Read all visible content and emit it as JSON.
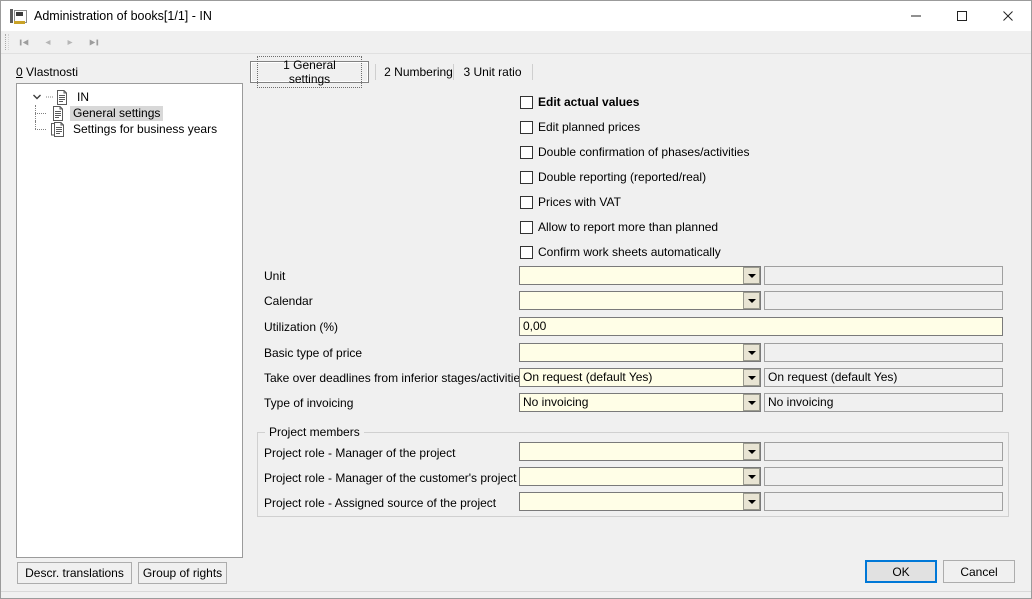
{
  "window": {
    "title": "Administration of books[1/1] - IN",
    "app_icon": "book-document-icon",
    "controls": {
      "minimize": "minimize-icon",
      "maximize": "maximize-icon",
      "close": "close-icon"
    }
  },
  "toolbar": {
    "buttons": [
      {
        "name": "first-record",
        "icon": "first-record-icon"
      },
      {
        "name": "previous-record",
        "icon": "previous-record-icon"
      },
      {
        "name": "next-record",
        "icon": "next-record-icon"
      },
      {
        "name": "last-record",
        "icon": "last-record-icon"
      }
    ]
  },
  "left_pane": {
    "caption_accel": "0",
    "caption_text": " Vlastnosti",
    "tree": {
      "root": {
        "label": "IN",
        "expanded": true
      },
      "children": [
        {
          "label": "General settings",
          "selected": true
        },
        {
          "label": "Settings for business years",
          "selected": false
        }
      ]
    },
    "buttons": {
      "descr_translations": "Descr. translations",
      "group_of_rights": "Group of rights"
    }
  },
  "tabs": [
    {
      "label": "1 General settings",
      "active": true
    },
    {
      "label": "2 Numbering",
      "active": false
    },
    {
      "label": "3 Unit ratio",
      "active": false
    }
  ],
  "checkboxes": [
    {
      "label": "Edit actual values",
      "checked": false,
      "bold": true
    },
    {
      "label": "Edit planned prices",
      "checked": false,
      "bold": false
    },
    {
      "label": "Double confirmation of phases/activities",
      "checked": false,
      "bold": false
    },
    {
      "label": "Double reporting (reported/real)",
      "checked": false,
      "bold": false
    },
    {
      "label": "Prices with VAT",
      "checked": false,
      "bold": false
    },
    {
      "label": "Allow to report more than planned",
      "checked": false,
      "bold": false
    },
    {
      "label": "Confirm work sheets automatically",
      "checked": false,
      "bold": false
    }
  ],
  "fields": [
    {
      "label": "Unit",
      "type": "combo",
      "value": "",
      "readonly_value": ""
    },
    {
      "label": "Calendar",
      "type": "combo",
      "value": "",
      "readonly_value": ""
    },
    {
      "label": "Utilization (%)",
      "type": "text",
      "value": "0,00"
    },
    {
      "label": "Basic type of price",
      "type": "combo",
      "value": "",
      "readonly_value": ""
    },
    {
      "label": "Take over deadlines from inferior stages/activitie...",
      "type": "combo",
      "value": "On request (default Yes)",
      "readonly_value": "On request (default Yes)"
    },
    {
      "label": "Type of invoicing",
      "type": "combo",
      "value": "No invoicing",
      "readonly_value": "No invoicing"
    }
  ],
  "group": {
    "title": "Project members",
    "fields": [
      {
        "label": "Project role - Manager of the project",
        "value": "",
        "readonly_value": ""
      },
      {
        "label": "Project role - Manager of the customer's project",
        "value": "",
        "readonly_value": ""
      },
      {
        "label": "Project role - Assigned source of the project",
        "value": "",
        "readonly_value": ""
      }
    ]
  },
  "dialog_buttons": {
    "ok": "OK",
    "cancel": "Cancel"
  },
  "colors": {
    "editable_field_bg": "#FFFEE7",
    "readonly_field_bg": "#F0F0F0",
    "window_bg": "#F0F0F0",
    "focus_border": "#0078D7",
    "selection_bg": "#D8D8D8"
  }
}
